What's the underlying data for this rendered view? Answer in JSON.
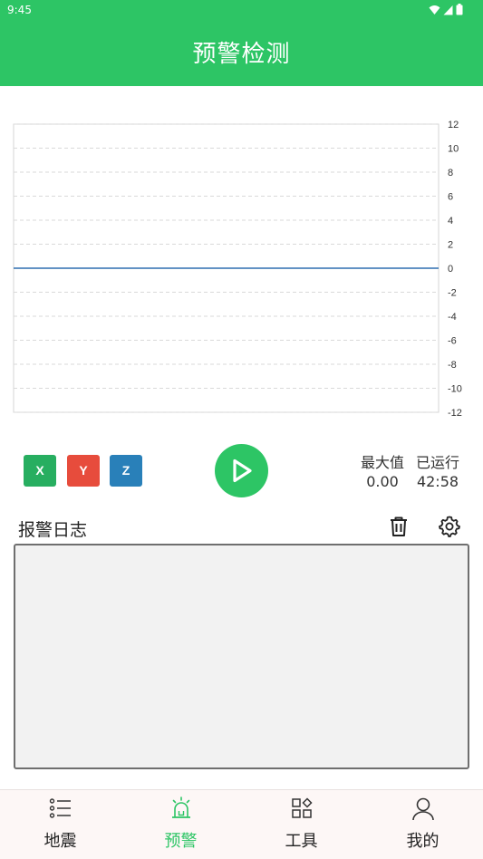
{
  "status_bar": {
    "time": "9:45"
  },
  "app_bar": {
    "title": "预警检测"
  },
  "chart_data": {
    "type": "line",
    "ylim": [
      -12,
      12
    ],
    "y_ticks": [
      "12",
      "10",
      "8",
      "6",
      "4",
      "2",
      "0",
      "-2",
      "-4",
      "-6",
      "-8",
      "-10",
      "-12"
    ],
    "grid": true,
    "series": [
      {
        "color": "#2e6fb0",
        "values": [
          0,
          0
        ]
      }
    ]
  },
  "axis_buttons": {
    "x": "X",
    "y": "Y",
    "z": "Z"
  },
  "stats": {
    "max_label": "最大值",
    "max_value": "0.00",
    "run_label": "已运行",
    "run_value": "42:58"
  },
  "log": {
    "title": "报警日志"
  },
  "colors": {
    "primary": "#2dc565",
    "x_button": "#27ae60",
    "y_button": "#e74c3c",
    "z_button": "#2980b9"
  },
  "icons": {
    "play": "play-icon",
    "trash": "trash-icon",
    "settings": "gear-icon"
  },
  "nav": [
    {
      "label": "地震",
      "icon": "list-icon",
      "active": false
    },
    {
      "label": "预警",
      "icon": "alarm-icon",
      "active": true
    },
    {
      "label": "工具",
      "icon": "grid-icon",
      "active": false
    },
    {
      "label": "我的",
      "icon": "user-icon",
      "active": false
    }
  ]
}
